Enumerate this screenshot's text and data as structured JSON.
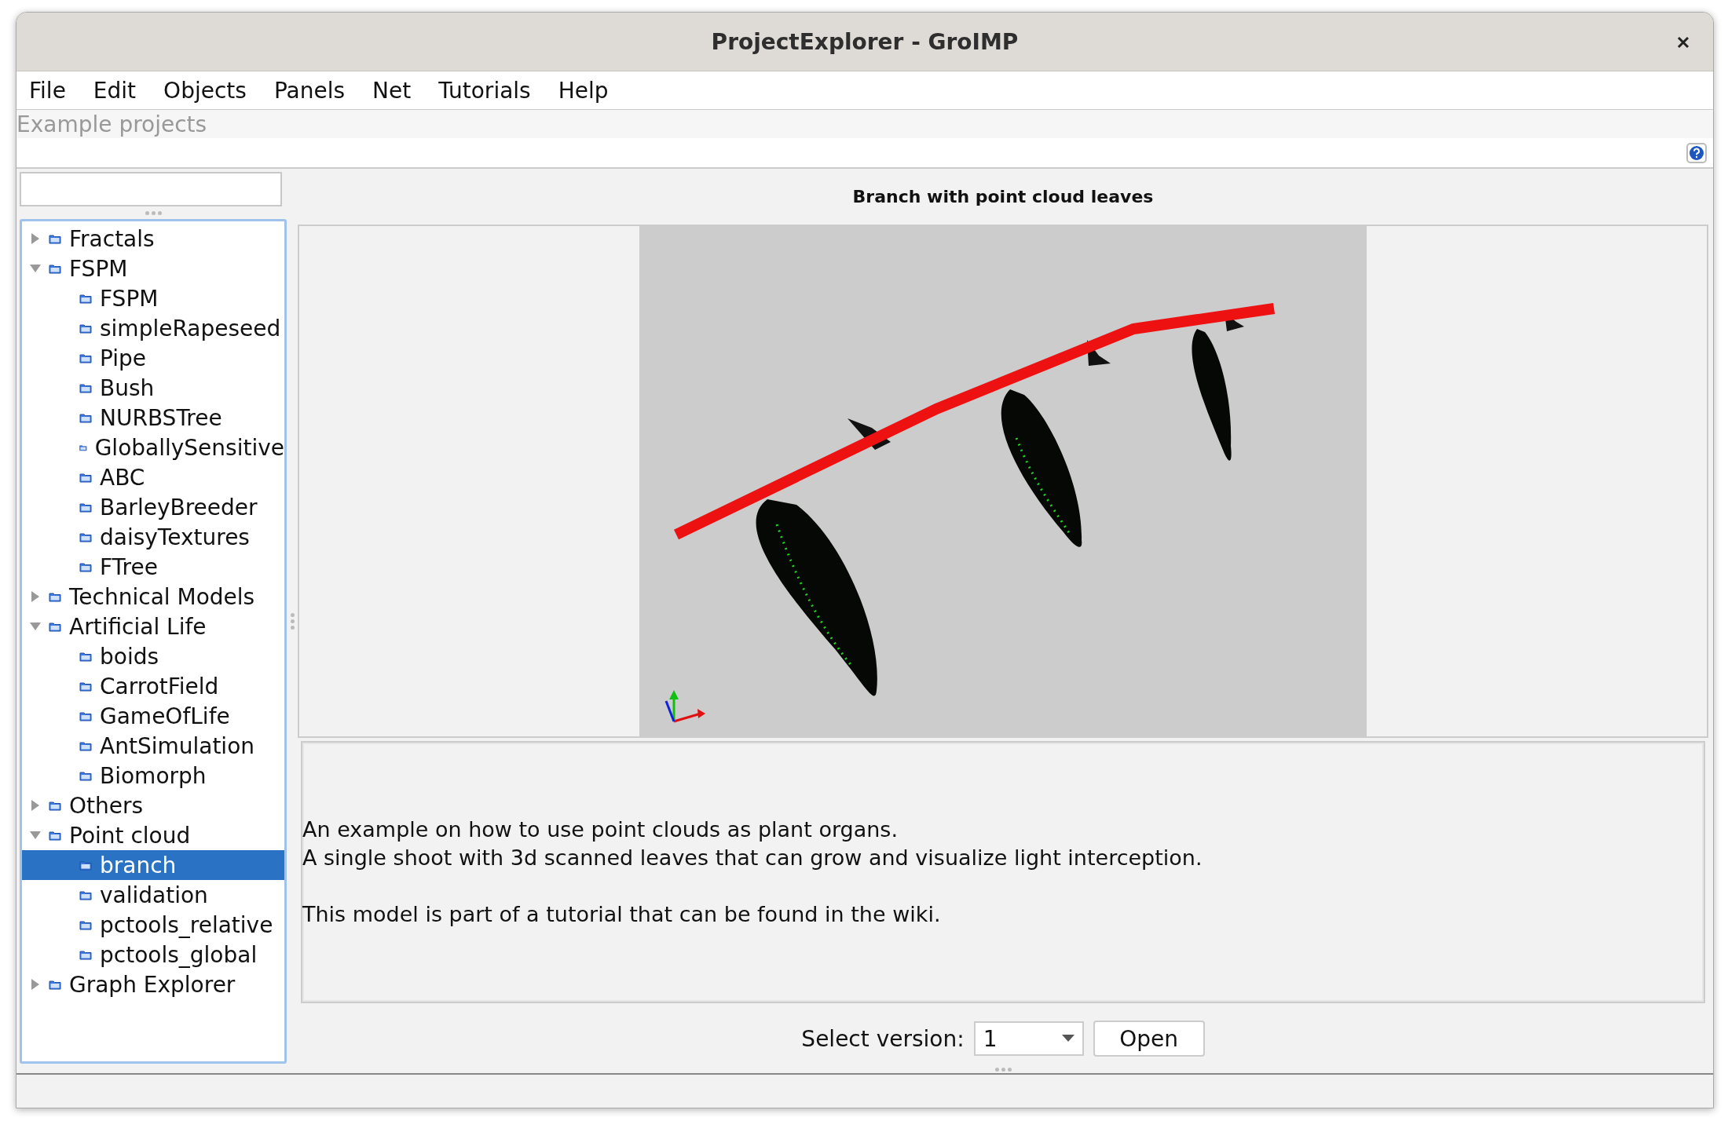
{
  "window": {
    "title": "ProjectExplorer - GroIMP"
  },
  "menu": [
    "File",
    "Edit",
    "Objects",
    "Panels",
    "Net",
    "Tutorials",
    "Help"
  ],
  "header": {
    "title": "Example projects"
  },
  "tree": [
    {
      "label": "Fractals",
      "expanded": false,
      "selected": false
    },
    {
      "label": "FSPM",
      "expanded": true,
      "selected": false,
      "children": [
        {
          "label": "FSPM",
          "selected": false
        },
        {
          "label": "simpleRapeseed",
          "selected": false
        },
        {
          "label": "Pipe",
          "selected": false
        },
        {
          "label": "Bush",
          "selected": false
        },
        {
          "label": "NURBSTree",
          "selected": false
        },
        {
          "label": "GloballySensitive",
          "selected": false
        },
        {
          "label": "ABC",
          "selected": false
        },
        {
          "label": "BarleyBreeder",
          "selected": false
        },
        {
          "label": "daisyTextures",
          "selected": false
        },
        {
          "label": "FTree",
          "selected": false
        }
      ]
    },
    {
      "label": "Technical Models",
      "expanded": false,
      "selected": false
    },
    {
      "label": "Artificial Life",
      "expanded": true,
      "selected": false,
      "children": [
        {
          "label": "boids",
          "selected": false
        },
        {
          "label": "CarrotField",
          "selected": false
        },
        {
          "label": "GameOfLife",
          "selected": false
        },
        {
          "label": "AntSimulation",
          "selected": false
        },
        {
          "label": "Biomorph",
          "selected": false
        }
      ]
    },
    {
      "label": "Others",
      "expanded": false,
      "selected": false
    },
    {
      "label": "Point cloud",
      "expanded": true,
      "selected": false,
      "children": [
        {
          "label": "branch",
          "selected": true
        },
        {
          "label": "validation",
          "selected": false
        },
        {
          "label": "pctools_relative",
          "selected": false
        },
        {
          "label": "pctools_global",
          "selected": false
        }
      ]
    },
    {
      "label": "Graph Explorer",
      "expanded": false,
      "selected": false
    }
  ],
  "preview": {
    "title": "Branch with point cloud leaves",
    "paragraphs": [
      {
        "lines": [
          "An example on how to use point clouds as plant organs.",
          "A single shoot with 3d scanned leaves that can grow and visualize light interception."
        ]
      },
      {
        "lines": [
          "This model is part of a tutorial that can be found in the wiki."
        ]
      }
    ]
  },
  "version": {
    "label": "Select version:",
    "value": "1",
    "button": "Open"
  }
}
